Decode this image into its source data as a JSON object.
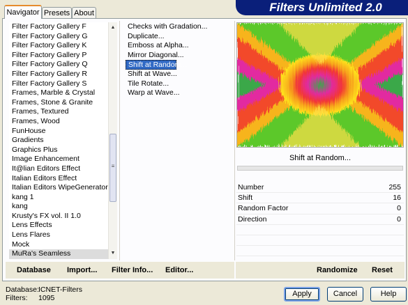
{
  "app": {
    "title": "Filters Unlimited 2.0"
  },
  "tabs": [
    {
      "label": "Navigator",
      "active": true
    },
    {
      "label": "Presets",
      "active": false
    },
    {
      "label": "About",
      "active": false
    }
  ],
  "categories": {
    "items": [
      "Filter Factory Gallery F",
      "Filter Factory Gallery G",
      "Filter Factory Gallery K",
      "Filter Factory Gallery P",
      "Filter Factory Gallery Q",
      "Filter Factory Gallery R",
      "Filter Factory Gallery S",
      "Frames, Marble & Crystal",
      "Frames, Stone & Granite",
      "Frames, Textured",
      "Frames, Wood",
      "FunHouse",
      "Gradients",
      "Graphics Plus",
      "Image Enhancement",
      "It@lian Editors Effect",
      "Italian Editors Effect",
      "Italian Editors WipeGenerator",
      "kang 1",
      "kang",
      "Krusty's FX vol. II 1.0",
      "Lens Effects",
      "Lens Flares",
      "Mock",
      "MuRa's Seamless"
    ],
    "selected": "MuRa's Seamless"
  },
  "filters": {
    "items": [
      "Checks with Gradation...",
      "Duplicate...",
      "Emboss at Alpha...",
      "Mirror Diagonal...",
      "Shift at Random...",
      "Shift at Wave...",
      "Tile Rotate...",
      "Warp at Wave..."
    ],
    "selected": "Shift at Random..."
  },
  "left_toolbar": {
    "database": "Database",
    "import": "Import...",
    "filter_info": "Filter Info...",
    "editor": "Editor..."
  },
  "preview": {
    "filter_button_label": "Shift at Random..."
  },
  "params": [
    {
      "label": "Number",
      "value": "255"
    },
    {
      "label": "Shift",
      "value": "16"
    },
    {
      "label": "Random Factor",
      "value": "0"
    },
    {
      "label": "Direction",
      "value": "0"
    }
  ],
  "right_toolbar": {
    "randomize": "Randomize",
    "reset": "Reset"
  },
  "footer": {
    "database_label": "Database:",
    "database_value": "ICNET-Filters",
    "filters_label": "Filters:",
    "filters_value": "1095"
  },
  "buttons": {
    "apply": "Apply",
    "cancel": "Cancel",
    "help": "Help"
  },
  "colors": {
    "title_banner": "#0a1f7a",
    "selection": "#316ac5",
    "tab_accent": "#e68b2c"
  }
}
